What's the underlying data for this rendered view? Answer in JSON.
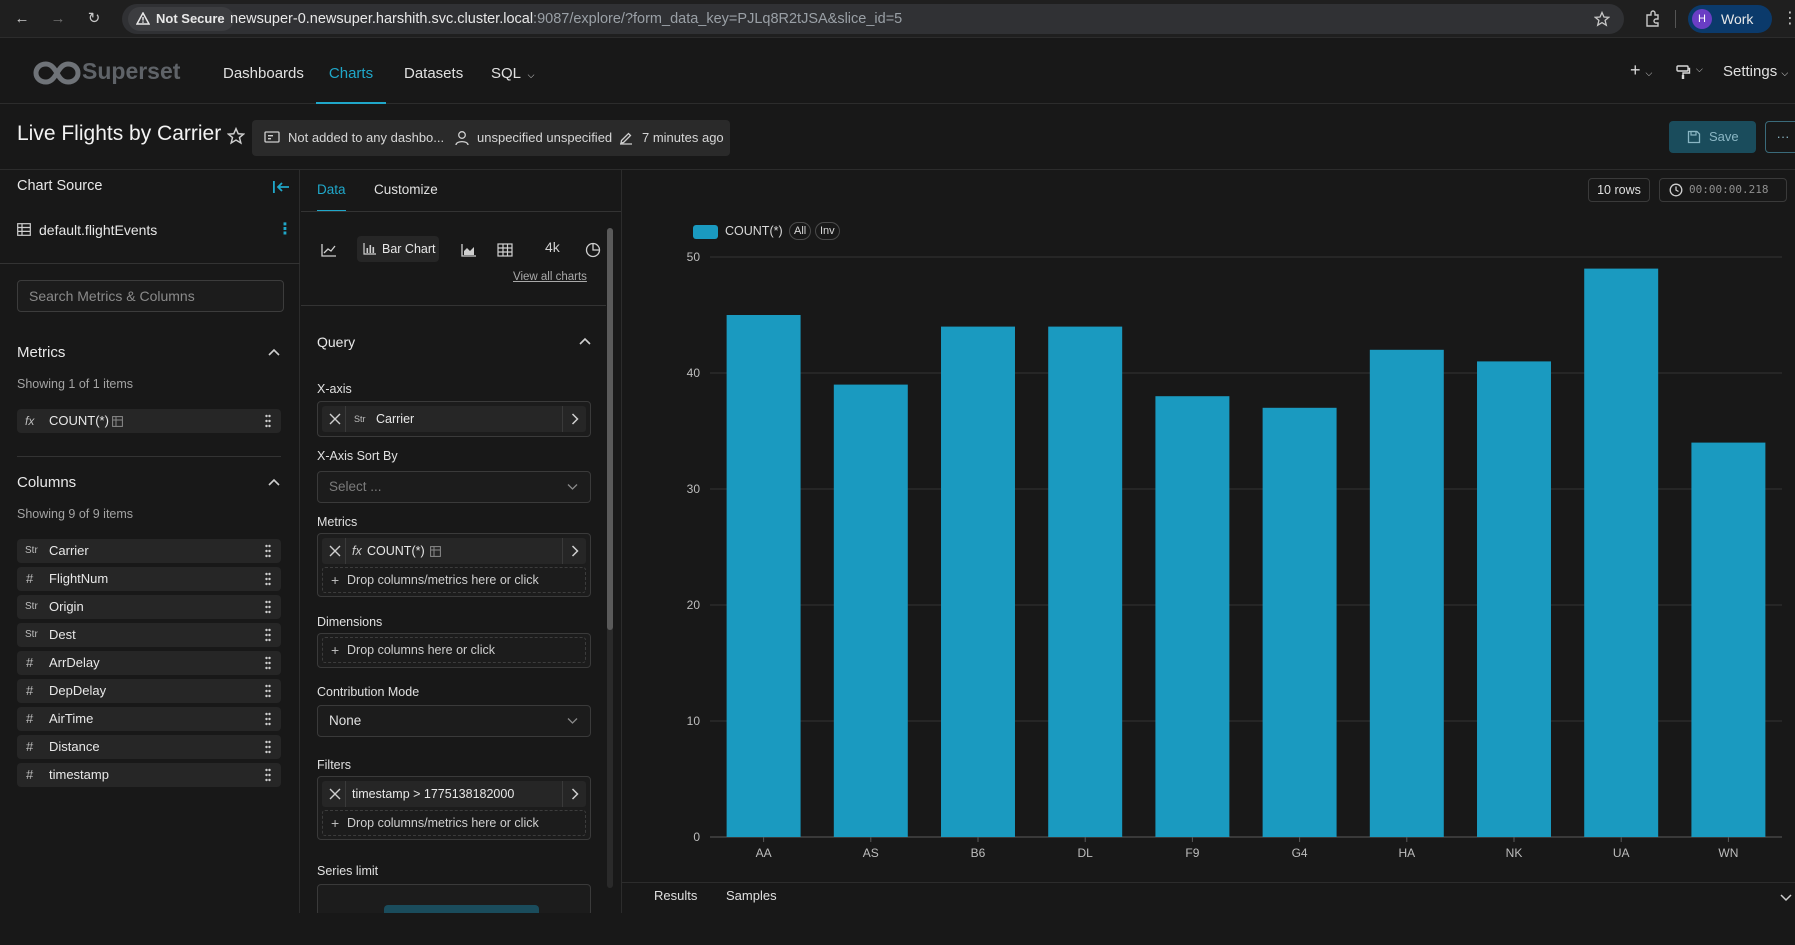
{
  "browser": {
    "security_label": "Not Secure",
    "url_host": "newsuper-0.newsuper.harshith.svc.cluster.local",
    "url_rest": ":9087/explore/?form_data_key=PJLq8R2tJSA&slice_id=5",
    "profile_initial": "H",
    "profile_label": "Work"
  },
  "header": {
    "logo_text": "Superset",
    "nav": [
      "Dashboards",
      "Charts",
      "Datasets",
      "SQL"
    ],
    "active_nav": "Charts",
    "settings_label": "Settings"
  },
  "titlebar": {
    "title": "Live Flights by Carrier",
    "dashboard_status": "Not added to any dashbo...",
    "owner": "unspecified unspecified",
    "modified": "7 minutes ago",
    "save_label": "Save",
    "more_label": "···"
  },
  "datasource": {
    "section_title": "Chart Source",
    "dataset_name": "default.flightEvents",
    "search_placeholder": "Search Metrics & Columns",
    "metrics_title": "Metrics",
    "metrics_count": "Showing 1 of 1 items",
    "metrics": [
      {
        "type": "fx",
        "name": "COUNT(*)"
      }
    ],
    "columns_title": "Columns",
    "columns_count": "Showing 9 of 9 items",
    "columns": [
      {
        "type": "str",
        "name": "Carrier"
      },
      {
        "type": "num",
        "name": "FlightNum"
      },
      {
        "type": "str",
        "name": "Origin"
      },
      {
        "type": "str",
        "name": "Dest"
      },
      {
        "type": "num",
        "name": "ArrDelay"
      },
      {
        "type": "num",
        "name": "DepDelay"
      },
      {
        "type": "num",
        "name": "AirTime"
      },
      {
        "type": "num",
        "name": "Distance"
      },
      {
        "type": "num",
        "name": "timestamp"
      }
    ]
  },
  "controls": {
    "tabs": [
      "Data",
      "Customize"
    ],
    "active_tab": "Data",
    "viz_selected": "Bar Chart",
    "viz_4k": "4k",
    "view_all": "View all charts",
    "query_title": "Query",
    "xaxis_label": "X-axis",
    "xaxis_value": "Carrier",
    "xaxis_sort_label": "X-Axis Sort By",
    "xaxis_sort_placeholder": "Select ...",
    "metrics_label": "Metrics",
    "metric_value": "COUNT(*)",
    "drop_metrics": "Drop columns/metrics here or click",
    "dimensions_label": "Dimensions",
    "drop_columns": "Drop columns here or click",
    "contribution_label": "Contribution Mode",
    "contribution_value": "None",
    "filters_label": "Filters",
    "filter_value": "timestamp > 1775138182000",
    "drop_filters": "Drop columns/metrics here or click",
    "series_limit_label": "Series limit"
  },
  "chart_panel": {
    "rows_badge": "10 rows",
    "timer": "00:00:00.218",
    "legend_label": "COUNT(*)",
    "legend_all": "All",
    "legend_inv": "Inv",
    "results_tab": "Results",
    "samples_tab": "Samples"
  },
  "colors": {
    "accent": "#20a7c9",
    "bar": "#1a9ac0",
    "background": "#181818"
  },
  "chart_data": {
    "type": "bar",
    "categories": [
      "AA",
      "AS",
      "B6",
      "DL",
      "F9",
      "G4",
      "HA",
      "NK",
      "UA",
      "WN"
    ],
    "series": [
      {
        "name": "COUNT(*)",
        "values": [
          45,
          39,
          44,
          44,
          38,
          37,
          42,
          41,
          49,
          34
        ]
      }
    ],
    "ylim": [
      0,
      50
    ],
    "yticks": [
      0,
      10,
      20,
      30,
      40,
      50
    ],
    "grid": true,
    "legend": "top-left"
  }
}
